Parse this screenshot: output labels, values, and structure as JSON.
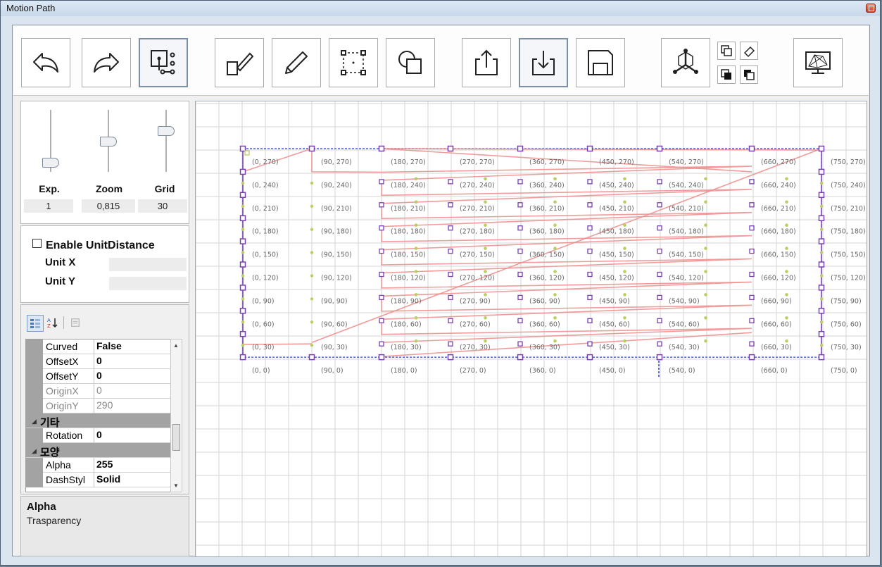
{
  "window": {
    "title": "Motion Path"
  },
  "toolbar": {
    "buttons": [
      {
        "name": "undo-button",
        "icon": "undo-arrow-icon"
      },
      {
        "name": "redo-button",
        "icon": "redo-arrow-icon"
      },
      {
        "name": "select-points-button",
        "icon": "select-points-icon",
        "active": true
      },
      {
        "name": "draw-line-button",
        "icon": "pen-line-icon"
      },
      {
        "name": "pencil-button",
        "icon": "pencil-icon"
      },
      {
        "name": "bounding-box-button",
        "icon": "bounding-box-icon"
      },
      {
        "name": "shapes-button",
        "icon": "shapes-icon"
      },
      {
        "name": "export-button",
        "icon": "export-icon"
      },
      {
        "name": "import-button",
        "icon": "import-icon",
        "active": true
      },
      {
        "name": "save-button",
        "icon": "save-disk-icon"
      },
      {
        "name": "3d-axis-button",
        "icon": "3d-axis-icon"
      },
      {
        "name": "copy-button",
        "icon": "copy-icon"
      },
      {
        "name": "erase-button",
        "icon": "eraser-icon"
      },
      {
        "name": "bring-front-button",
        "icon": "bring-front-icon"
      },
      {
        "name": "send-back-button",
        "icon": "send-back-icon"
      },
      {
        "name": "preview-button",
        "icon": "wireframe-monitor-icon"
      }
    ]
  },
  "sliders": [
    {
      "label": "Exp.",
      "value": "1",
      "level": 0.1
    },
    {
      "label": "Zoom",
      "value": "0,815",
      "level": 0.5
    },
    {
      "label": "Grid",
      "value": "30",
      "level": 0.7
    }
  ],
  "unit": {
    "enable_label": "Enable UnitDistance",
    "enabled": false,
    "x_label": "Unit X",
    "y_label": "Unit Y",
    "x_value": "",
    "y_value": ""
  },
  "properties": {
    "rows": [
      {
        "type": "prop",
        "key": "Curved",
        "value": "False"
      },
      {
        "type": "prop",
        "key": "OffsetX",
        "value": "0"
      },
      {
        "type": "prop",
        "key": "OffsetY",
        "value": "0"
      },
      {
        "type": "prop",
        "key": "OriginX",
        "value": "0",
        "dim": true
      },
      {
        "type": "prop",
        "key": "OriginY",
        "value": "290",
        "dim": true
      },
      {
        "type": "cat",
        "key": "기타"
      },
      {
        "type": "prop",
        "key": "Rotation",
        "value": "0"
      },
      {
        "type": "cat",
        "key": "모양"
      },
      {
        "type": "prop",
        "key": "Alpha",
        "value": "255"
      },
      {
        "type": "prop",
        "key": "DashStyl",
        "value": "Solid"
      }
    ],
    "description_title": "Alpha",
    "description_text": "Trasparency"
  },
  "canvas": {
    "x_labels": [
      "0",
      "90",
      "180",
      "270",
      "360",
      "450",
      "540",
      "660",
      "750"
    ],
    "y_labels": [
      "270",
      "240",
      "210",
      "180",
      "150",
      "120",
      "90",
      "60",
      "30",
      "0"
    ],
    "point_labels": [
      [
        "(0, 270)",
        "(90, 270)",
        "(180, 270)",
        "(270, 270)",
        "(360, 270)",
        "(450, 270)",
        "(540, 270)",
        "(660, 270)",
        "(750, 270)"
      ],
      [
        "(0, 240)",
        "(90, 240)",
        "(180, 240)",
        "(270, 240)",
        "(360, 240)",
        "(450, 240)",
        "(540, 240)",
        "(660, 240)",
        "(750, 240)"
      ],
      [
        "(0, 210)",
        "(90, 210)",
        "(180, 210)",
        "(270, 210)",
        "(360, 210)",
        "(450, 210)",
        "(540, 210)",
        "(660, 210)",
        "(750, 210)"
      ],
      [
        "(0, 180)",
        "(90, 180)",
        "(180, 180)",
        "(270, 180)",
        "(360, 180)",
        "(450, 180)",
        "(540, 180)",
        "(660, 180)",
        "(750, 180)"
      ],
      [
        "(0, 150)",
        "(90, 150)",
        "(180, 150)",
        "(270, 150)",
        "(360, 150)",
        "(450, 150)",
        "(540, 150)",
        "(660, 150)",
        "(750, 150)"
      ],
      [
        "(0, 120)",
        "(90, 120)",
        "(180, 120)",
        "(270, 120)",
        "(360, 120)",
        "(450, 120)",
        "(540, 120)",
        "(660, 120)",
        "(750, 120)"
      ],
      [
        "(0, 90)",
        "(90, 90)",
        "(180, 90)",
        "(270, 90)",
        "(360, 90)",
        "(450, 90)",
        "(540, 90)",
        "(660, 90)",
        "(750, 90)"
      ],
      [
        "(0, 60)",
        "(90, 60)",
        "(180, 60)",
        "(270, 60)",
        "(360, 60)",
        "(450, 60)",
        "(540, 60)",
        "(660, 60)",
        "(750, 60)"
      ],
      [
        "(0, 30)",
        "(90, 30)",
        "(180, 30)",
        "(270, 30)",
        "(360, 30)",
        "(450, 30)",
        "(540, 30)",
        "(660, 30)",
        "(750, 30)"
      ],
      [
        "(0, 0)",
        "(90, 0)",
        "(180, 0)",
        "(270, 0)",
        "(360, 0)",
        "(450, 0)",
        "(540, 0)",
        "(660, 0)",
        "(750, 0)"
      ]
    ],
    "colors": {
      "path": "#f08a8a",
      "marker": "#7a3fb0",
      "guide": "#2a3ad8",
      "dot": "#b8d060",
      "grid": "#d6d6d6"
    }
  }
}
